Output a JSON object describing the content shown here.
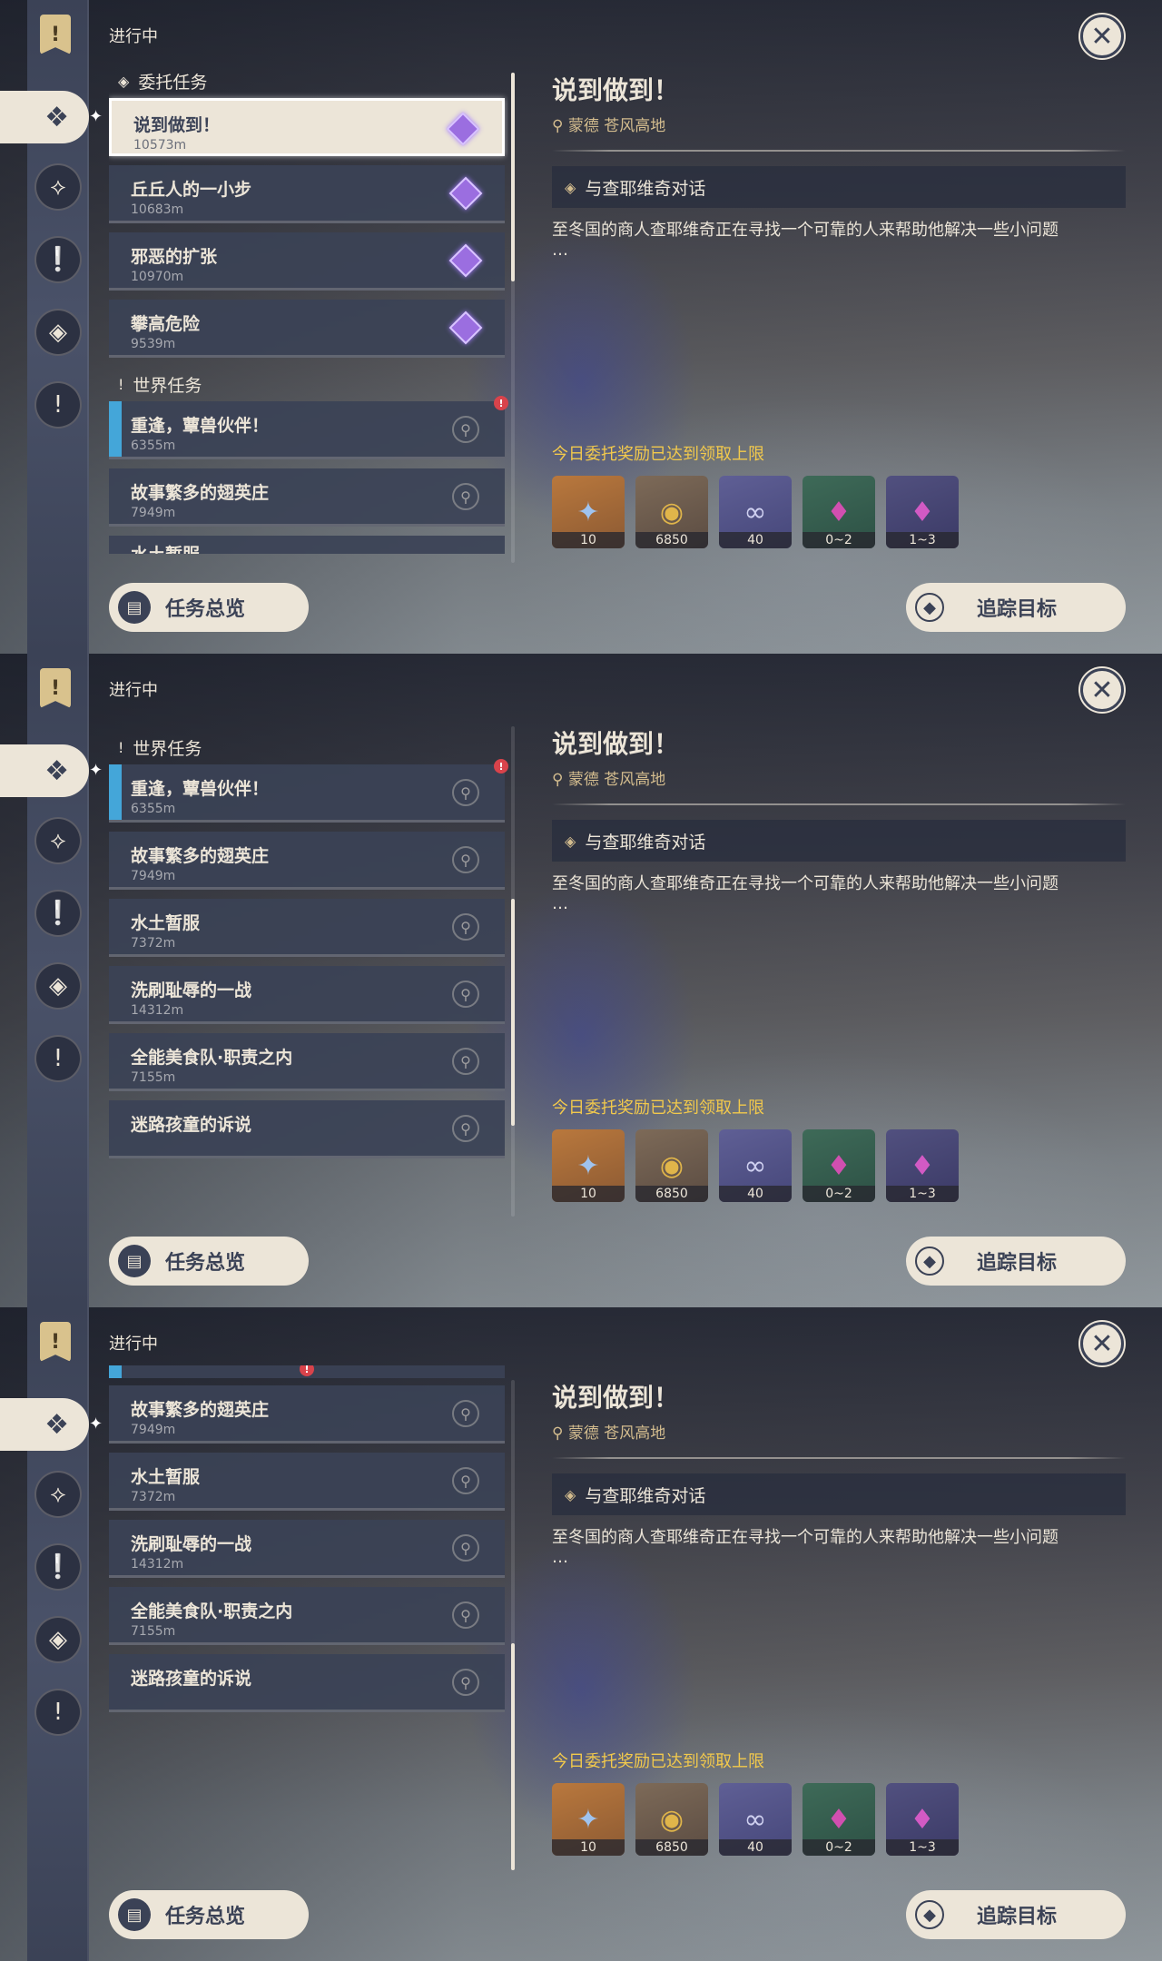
{
  "header": {
    "status": "进行中"
  },
  "rail": {
    "top_icon": "quest-banner-icon",
    "buttons": [
      "commission-icon",
      "archon-icon",
      "story-icon",
      "world-icon",
      "event-icon"
    ]
  },
  "sections": {
    "commission": "委托任务",
    "world": "世界任务"
  },
  "commissions": [
    {
      "name": "说到做到！",
      "distance": "10573m"
    },
    {
      "name": "丘丘人的一小步",
      "distance": "10683m"
    },
    {
      "name": "邪恶的扩张",
      "distance": "10970m"
    },
    {
      "name": "攀高危险",
      "distance": "9539m"
    }
  ],
  "world_quests": [
    {
      "name": "重逢，蕈兽伙伴！",
      "distance": "6355m"
    },
    {
      "name": "故事繁多的翅英庄",
      "distance": "7949m"
    },
    {
      "name": "水土暂服",
      "distance": "7372m"
    },
    {
      "name": "洗刷耻辱的一战",
      "distance": "14312m"
    },
    {
      "name": "全能美食队·职责之内",
      "distance": "7155m"
    },
    {
      "name": "迷路孩童的诉说",
      "distance": ""
    }
  ],
  "peek": {
    "s1_bottom": "水土暂服"
  },
  "alert": {
    "glyph": "!"
  },
  "detail": {
    "title": "说到做到！",
    "location": "蒙德 苍风高地",
    "objective": "与查耶维奇对话",
    "description": "至冬国的商人查耶维奇正在寻找一个可靠的人来帮助他解决一些小问题",
    "ellipsis": "…",
    "reward_notice": "今日委托奖励已达到领取上限"
  },
  "rewards": [
    {
      "icon": "adventure-exp-icon",
      "glyph": "✦",
      "qty": "10"
    },
    {
      "icon": "mora-icon",
      "glyph": "◉",
      "qty": "6850"
    },
    {
      "icon": "companionship-exp-icon",
      "glyph": "∞",
      "qty": "40"
    },
    {
      "icon": "crystal-chunk-icon",
      "glyph": "♦",
      "qty": "0~2"
    },
    {
      "icon": "crystal-ore-icon",
      "glyph": "♦",
      "qty": "1~3"
    }
  ],
  "buttons": {
    "overview": "任务总览",
    "track": "追踪目标"
  },
  "close_icon": "close-icon"
}
